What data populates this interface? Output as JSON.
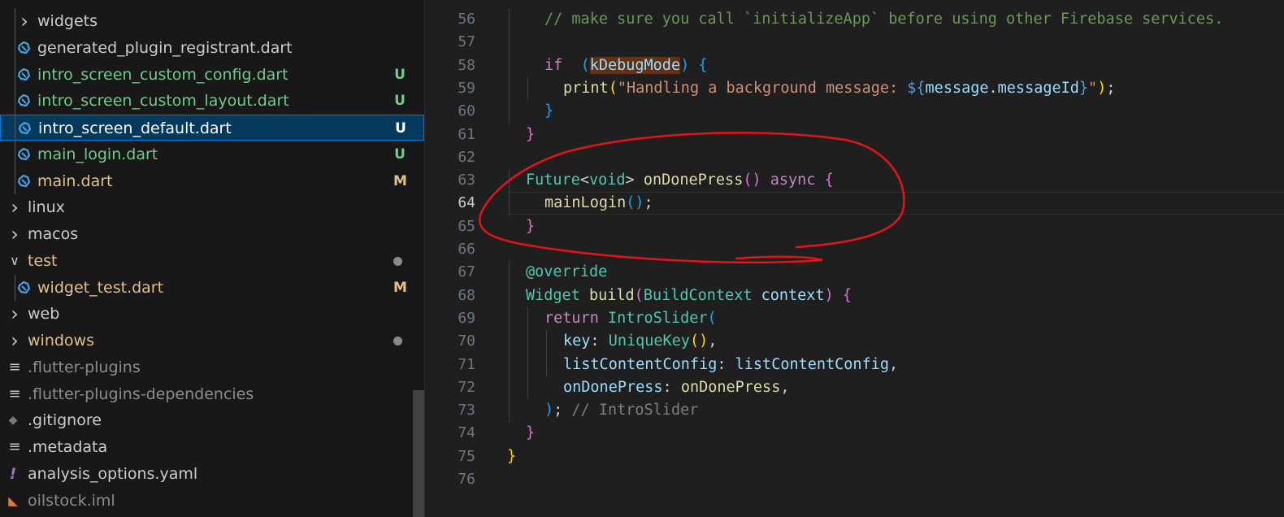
{
  "explorer": {
    "items": [
      {
        "label": "widgets",
        "kind": "folder",
        "state": "collapsed",
        "color": "#cccccc",
        "badge": ""
      },
      {
        "label": "generated_plugin_registrant.dart",
        "kind": "dart",
        "color": "#cccccc",
        "badge": ""
      },
      {
        "label": "intro_screen_custom_config.dart",
        "kind": "dart",
        "color": "#73c991",
        "badge": "U"
      },
      {
        "label": "intro_screen_custom_layout.dart",
        "kind": "dart",
        "color": "#73c991",
        "badge": "U"
      },
      {
        "label": "intro_screen_default.dart",
        "kind": "dart",
        "color": "#ffffff",
        "badge": "U",
        "selected": true
      },
      {
        "label": "main_login.dart",
        "kind": "dart",
        "color": "#73c991",
        "badge": "U"
      },
      {
        "label": "main.dart",
        "kind": "dart",
        "color": "#e2c08d",
        "badge": "M"
      },
      {
        "label": "linux",
        "kind": "folder",
        "state": "collapsed",
        "color": "#cccccc",
        "badge": ""
      },
      {
        "label": "macos",
        "kind": "folder",
        "state": "collapsed",
        "color": "#cccccc",
        "badge": ""
      },
      {
        "label": "test",
        "kind": "folder",
        "state": "expanded",
        "color": "#e2c08d",
        "badge": "dot"
      },
      {
        "label": "widget_test.dart",
        "kind": "dart",
        "color": "#e2c08d",
        "badge": "M"
      },
      {
        "label": "web",
        "kind": "folder",
        "state": "collapsed",
        "color": "#cccccc",
        "badge": ""
      },
      {
        "label": "windows",
        "kind": "folder",
        "state": "collapsed",
        "color": "#e2c08d",
        "badge": "dot"
      },
      {
        "label": ".flutter-plugins",
        "kind": "lines",
        "color": "#8c8c8c",
        "badge": ""
      },
      {
        "label": ".flutter-plugins-dependencies",
        "kind": "lines",
        "color": "#8c8c8c",
        "badge": ""
      },
      {
        "label": ".gitignore",
        "kind": "git",
        "color": "#cccccc",
        "badge": ""
      },
      {
        "label": ".metadata",
        "kind": "lines",
        "color": "#cccccc",
        "badge": ""
      },
      {
        "label": "analysis_options.yaml",
        "kind": "yaml",
        "color": "#cccccc",
        "badge": ""
      },
      {
        "label": "oilstock.iml",
        "kind": "rss",
        "color": "#8c8c8c",
        "badge": ""
      }
    ]
  },
  "editor": {
    "current_line": 64,
    "lines": [
      {
        "n": 56,
        "indent": 2,
        "tokens": [
          [
            "cm",
            "// make sure you call `initializeApp` before using other Firebase services."
          ]
        ]
      },
      {
        "n": 57,
        "indent": 0,
        "tokens": []
      },
      {
        "n": 58,
        "indent": 2,
        "tokens": [
          [
            "kw",
            "if"
          ],
          [
            "",
            "  "
          ],
          [
            "b3",
            "("
          ],
          [
            "vr hl",
            "kDebugMode"
          ],
          [
            "b3",
            ")"
          ],
          [
            "",
            " "
          ],
          [
            "b3",
            "{"
          ]
        ]
      },
      {
        "n": 59,
        "indent": 3,
        "tokens": [
          [
            "fn",
            "print"
          ],
          [
            "b1",
            "("
          ],
          [
            "st",
            "\"Handling a background message: "
          ],
          [
            "pk",
            "${"
          ],
          [
            "vr",
            "message"
          ],
          [
            "",
            ". "
          ],
          [
            "vr",
            "messageId"
          ],
          [
            "pk",
            "}"
          ],
          [
            "st",
            "\""
          ],
          [
            "b1",
            ")"
          ],
          [
            "",
            ";"
          ]
        ]
      },
      {
        "n": 60,
        "indent": 2,
        "tokens": [
          [
            "b3",
            "}"
          ]
        ]
      },
      {
        "n": 61,
        "indent": 1,
        "tokens": [
          [
            "b2",
            "}"
          ]
        ]
      },
      {
        "n": 62,
        "indent": 0,
        "tokens": []
      },
      {
        "n": 63,
        "indent": 1,
        "tokens": [
          [
            "ty",
            "Future"
          ],
          [
            "",
            "<"
          ],
          [
            "ty",
            "void"
          ],
          [
            "",
            "> "
          ],
          [
            "fn",
            "onDonePress"
          ],
          [
            "b2",
            "()"
          ],
          [
            "",
            " "
          ],
          [
            "kw",
            "async"
          ],
          [
            "",
            " "
          ],
          [
            "b2",
            "{"
          ]
        ]
      },
      {
        "n": 64,
        "indent": 2,
        "tokens": [
          [
            "fn",
            "mainLogin"
          ],
          [
            "b3",
            "()"
          ],
          [
            "",
            ";"
          ]
        ]
      },
      {
        "n": 65,
        "indent": 1,
        "tokens": [
          [
            "b2",
            "}"
          ]
        ]
      },
      {
        "n": 66,
        "indent": 0,
        "tokens": []
      },
      {
        "n": 67,
        "indent": 1,
        "tokens": [
          [
            "ty",
            "@override"
          ]
        ]
      },
      {
        "n": 68,
        "indent": 1,
        "tokens": [
          [
            "ty",
            "Widget"
          ],
          [
            "",
            " "
          ],
          [
            "fn",
            "build"
          ],
          [
            "b2",
            "("
          ],
          [
            "ty",
            "BuildContext"
          ],
          [
            "",
            " "
          ],
          [
            "vr",
            "context"
          ],
          [
            "b2",
            ")"
          ],
          [
            "",
            " "
          ],
          [
            "b2",
            "{"
          ]
        ]
      },
      {
        "n": 69,
        "indent": 2,
        "tokens": [
          [
            "kw",
            "return"
          ],
          [
            "",
            " "
          ],
          [
            "ty",
            "IntroSlider"
          ],
          [
            "b3",
            "("
          ]
        ]
      },
      {
        "n": 70,
        "indent": 3,
        "tokens": [
          [
            "vr",
            "key"
          ],
          [
            "",
            ": "
          ],
          [
            "ty",
            "UniqueKey"
          ],
          [
            "b1",
            "()"
          ],
          [
            "",
            ","
          ]
        ]
      },
      {
        "n": 71,
        "indent": 3,
        "tokens": [
          [
            "vr",
            "listContentConfig"
          ],
          [
            "",
            ": "
          ],
          [
            "vr",
            "listContentConfig"
          ],
          [
            "",
            ","
          ]
        ]
      },
      {
        "n": 72,
        "indent": 3,
        "tokens": [
          [
            "vr",
            "onDonePress"
          ],
          [
            "",
            ": "
          ],
          [
            "fn",
            "onDonePress"
          ],
          [
            "",
            ","
          ]
        ]
      },
      {
        "n": 73,
        "indent": 2,
        "tokens": [
          [
            "b3",
            ")"
          ],
          [
            "",
            "; "
          ],
          [
            "cm2",
            "// IntroSlider"
          ]
        ]
      },
      {
        "n": 74,
        "indent": 1,
        "tokens": [
          [
            "b2",
            "}"
          ]
        ]
      },
      {
        "n": 75,
        "indent": 0,
        "tokens": [
          [
            "b1",
            "}"
          ]
        ]
      },
      {
        "n": 76,
        "indent": 0,
        "tokens": []
      }
    ]
  },
  "annotation": {
    "color": "#e0151a",
    "shape": "hand-drawn-ellipse"
  }
}
